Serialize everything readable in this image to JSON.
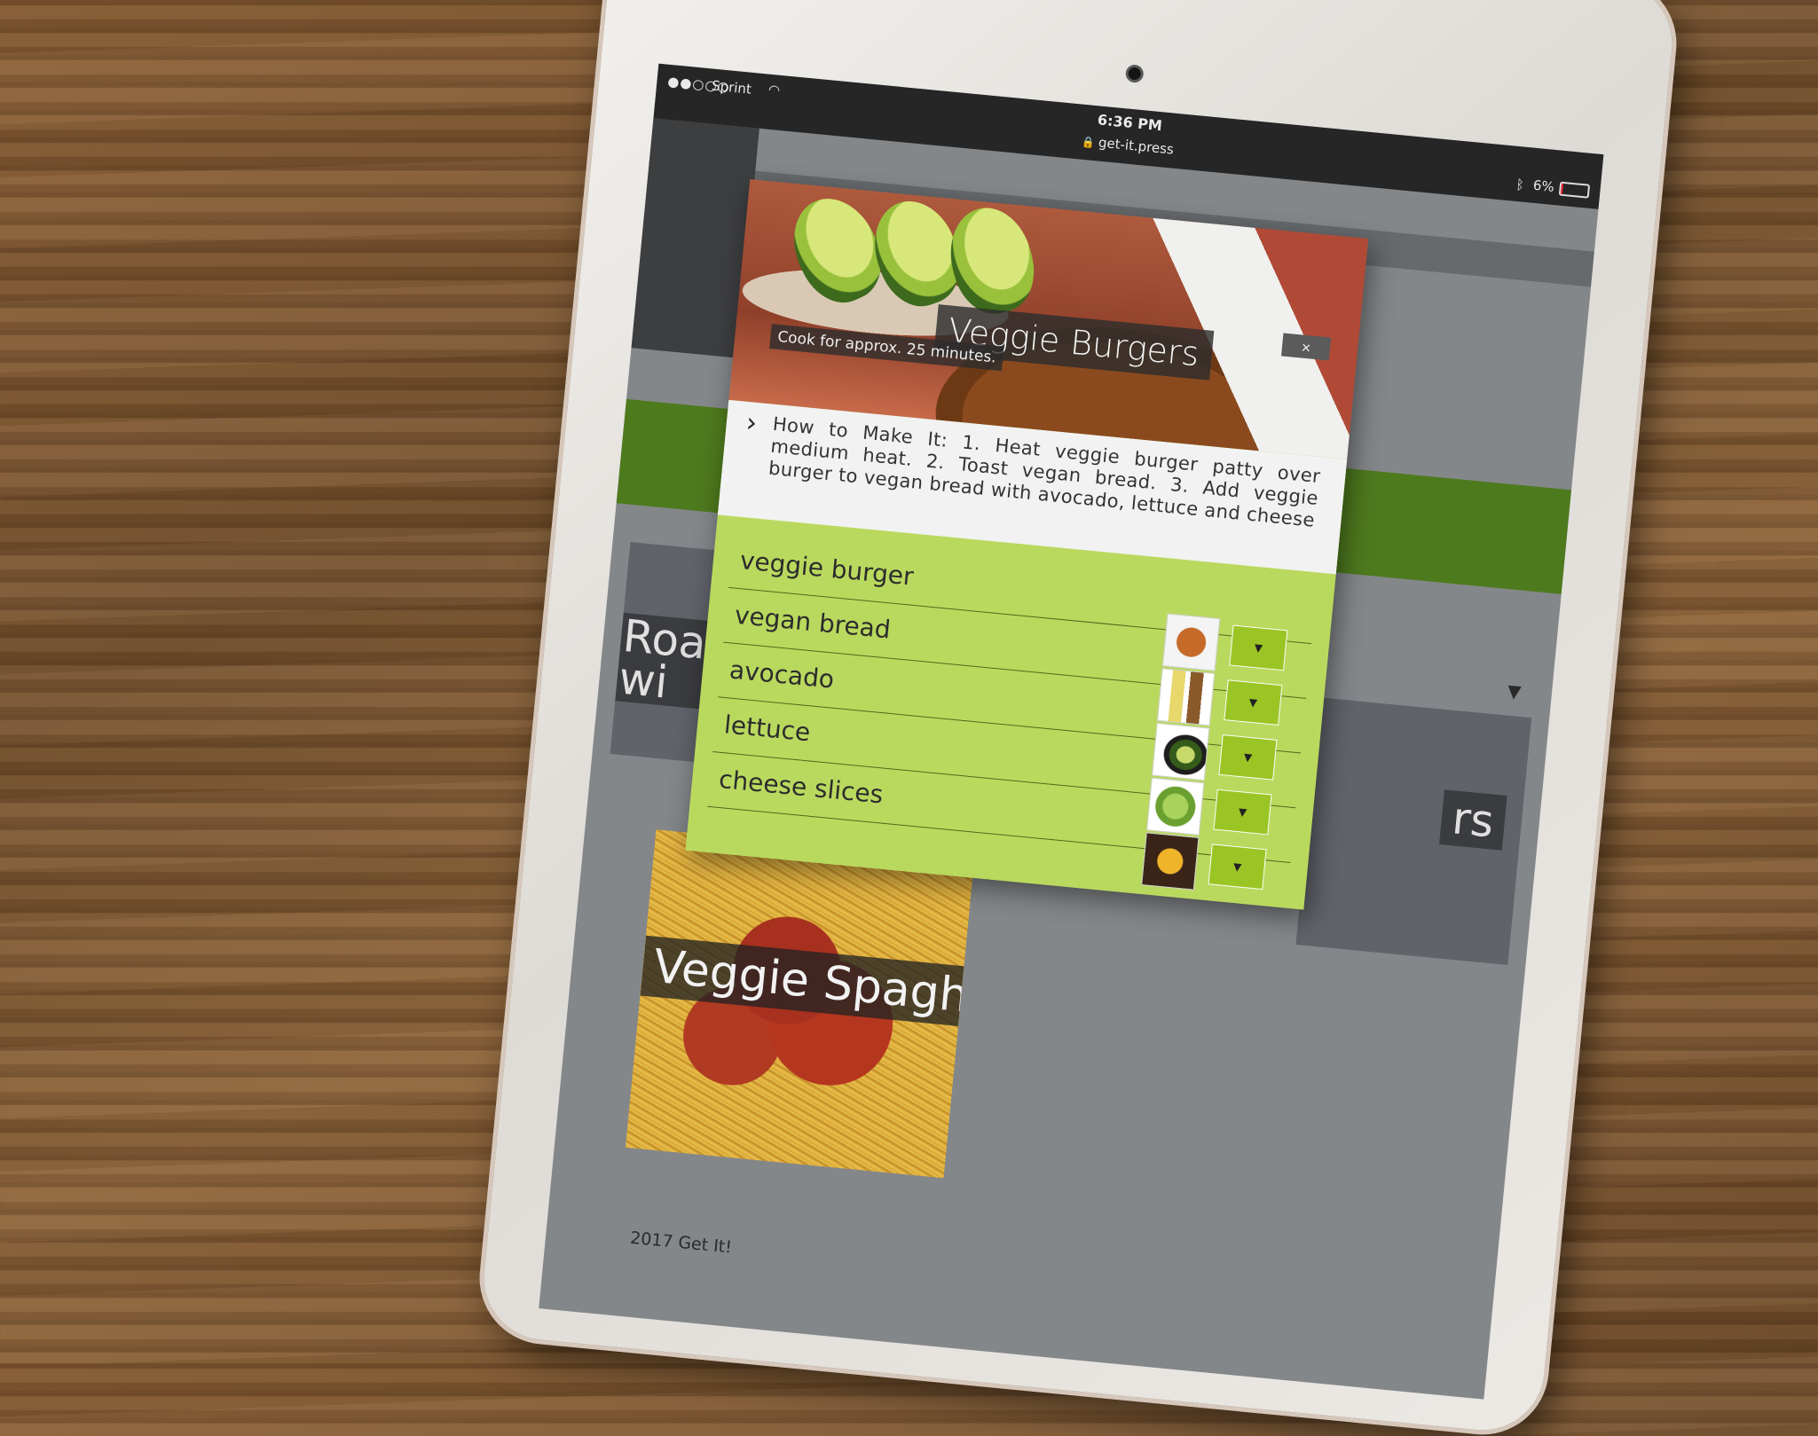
{
  "status_bar": {
    "signal": "●●○○○",
    "carrier": "Sprint",
    "time": "6:36 PM",
    "url": "get-it.press",
    "battery": "6%"
  },
  "modal": {
    "title": "Veggie Burgers",
    "subtitle": "Cook for approx. 25 minutes.",
    "close_label": "×",
    "instructions": "How to Make It: 1. Heat veggie burger patty over medium heat. 2. Toast vegan bread. 3. Add veggie burger to vegan bread with avocado, lettuce and cheese",
    "ingredients": [
      {
        "name": "veggie burger",
        "icon": "burger-patty-image"
      },
      {
        "name": "vegan bread",
        "icon": "oil-bottle-image"
      },
      {
        "name": "avocado",
        "icon": "avocado-image"
      },
      {
        "name": "lettuce",
        "icon": "lettuce-image"
      },
      {
        "name": "cheese slices",
        "icon": "cheese-slices-image"
      }
    ],
    "dropdown_arrow": "▼"
  },
  "background": {
    "card_left_label": "Roa\nwi",
    "card_right_label": "rs",
    "card_spaghetti_title": "Veggie Spaghetti",
    "footer": "2017 Get It!"
  },
  "colors": {
    "accent_green": "#b9d95e",
    "dark_green": "#4e7a1e",
    "dropdown_green": "#9bc525"
  }
}
